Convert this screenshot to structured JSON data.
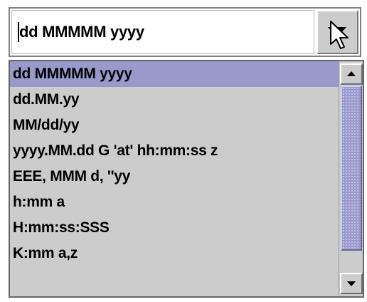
{
  "combo": {
    "selected_value": "dd MMMMM yyyy",
    "arrow_icon": "chevron-down-icon",
    "cursor_icon": "mouse-pointer-icon"
  },
  "dropdown": {
    "selected_index": 0,
    "selection_color": "#9999cc",
    "items": [
      {
        "label": "dd MMMMM yyyy"
      },
      {
        "label": "dd.MM.yy"
      },
      {
        "label": "MM/dd/yy"
      },
      {
        "label": "yyyy.MM.dd G 'at' hh:mm:ss z"
      },
      {
        "label": "EEE, MMM d, ''yy"
      },
      {
        "label": "h:mm a"
      },
      {
        "label": "H:mm:ss:SSS"
      },
      {
        "label": "K:mm a,z"
      }
    ],
    "scrollbar": {
      "up_icon": "arrow-up-icon",
      "down_icon": "arrow-down-icon",
      "scroll_position": 0
    }
  }
}
